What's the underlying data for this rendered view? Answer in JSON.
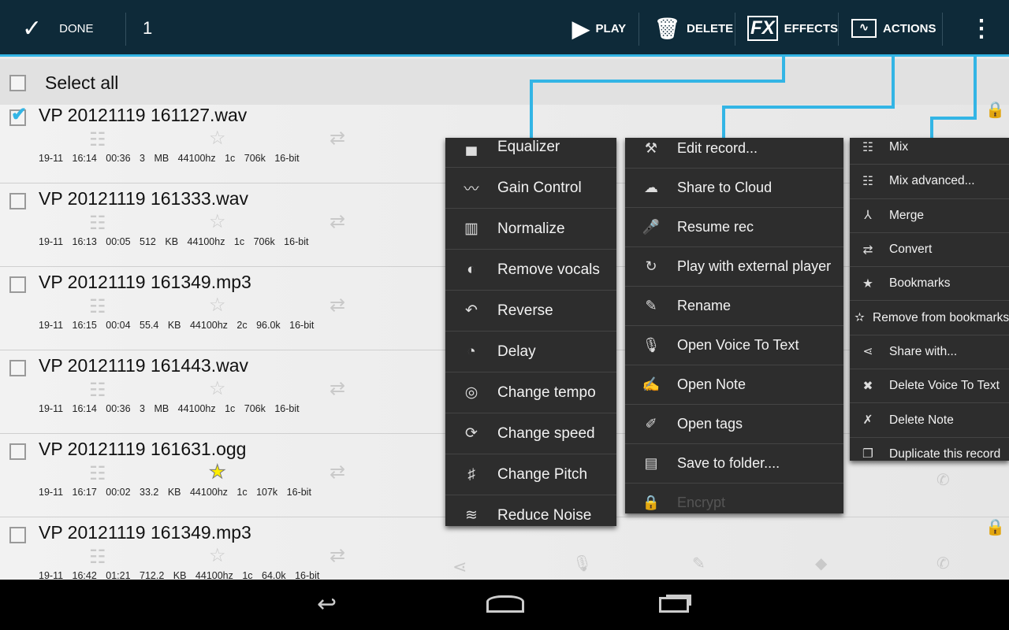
{
  "topbar": {
    "done": "DONE",
    "count": "1",
    "play": "PLAY",
    "delete": "DELETE",
    "effects": "EFFECTS",
    "actions": "ACTIONS",
    "fx_logo": "FX"
  },
  "select_all": "Select all",
  "rows": [
    {
      "title": "VP 20121119 161127.wav",
      "meta": "19-11 16:14  00:36  3 MB  44100hz  1c  706k  16-bit",
      "checked": true,
      "starred": false
    },
    {
      "title": "VP 20121119 161333.wav",
      "meta": "19-11 16:13  00:05  512 KB  44100hz  1c  706k  16-bit",
      "checked": false,
      "starred": false
    },
    {
      "title": "VP 20121119 161349.mp3",
      "meta": "19-11 16:15  00:04  55.4 KB  44100hz  2c  96.0k  16-bit",
      "checked": false,
      "starred": false
    },
    {
      "title": "VP 20121119 161443.wav",
      "meta": "19-11 16:14  00:36  3 MB  44100hz  1c  706k  16-bit",
      "checked": false,
      "starred": false
    },
    {
      "title": "VP 20121119 161631.ogg",
      "meta": "19-11 16:17  00:02  33.2 KB  44100hz  1c  107k  16-bit",
      "checked": false,
      "starred": true
    },
    {
      "title": "VP 20121119 161349.mp3",
      "meta": "19-11 16:42  01:21  712.2 KB  44100hz  1c  64.0k  16-bit",
      "checked": false,
      "starred": false
    }
  ],
  "effects_menu": [
    "Equalizer",
    "Gain Control",
    "Normalize",
    "Remove vocals",
    "Reverse",
    "Delay",
    "Change tempo",
    "Change speed",
    "Change Pitch",
    "Reduce Noise"
  ],
  "actions_menu": [
    "Edit record...",
    "Share to Cloud",
    "Resume rec",
    "Play with external player",
    "Rename",
    "Open Voice To Text",
    "Open Note",
    "Open tags",
    "Save to folder....",
    "Encrypt"
  ],
  "more_menu": [
    "Mix",
    "Mix advanced...",
    "Merge",
    "Convert",
    "Bookmarks",
    "Remove from bookmarks",
    "Share with...",
    "Delete Voice To Text",
    "Delete Note",
    "Duplicate this record"
  ],
  "colors": {
    "accent": "#33b5e5",
    "topbar": "#0e2a39",
    "menu": "#2d2d2d",
    "star": "#ffee00"
  }
}
